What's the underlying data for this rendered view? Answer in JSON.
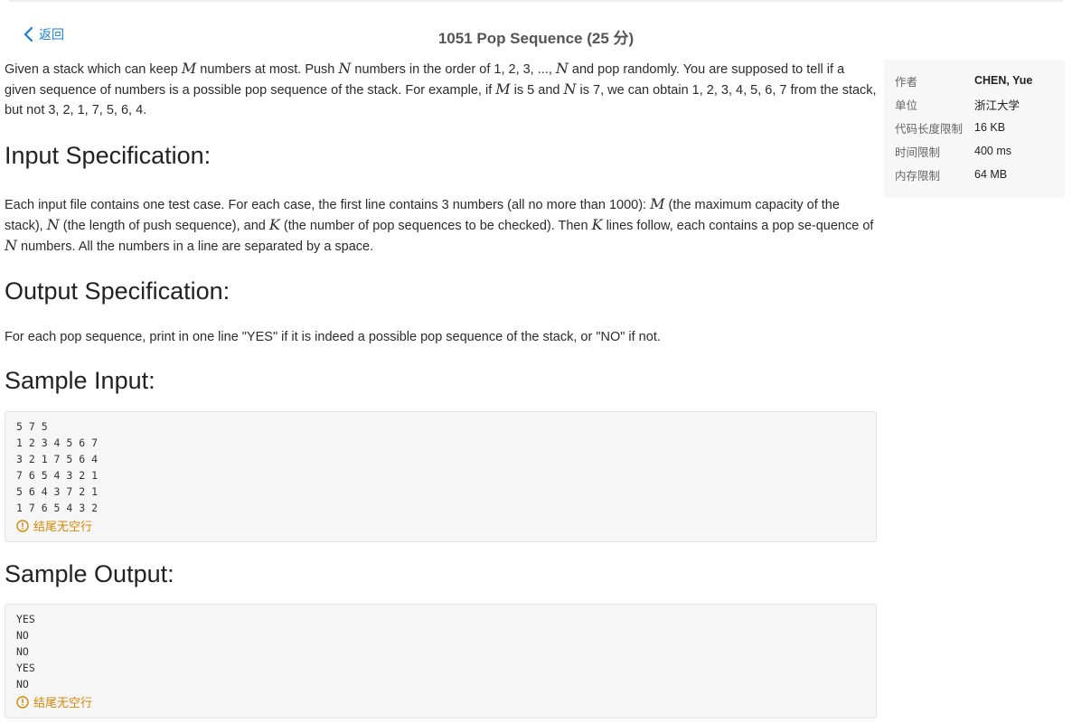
{
  "header": {
    "back_label": "返回",
    "title": "1051 Pop Sequence (25 分)"
  },
  "intro": {
    "p1": "Given a stack which can keep ",
    "m1": "M",
    "p2": " numbers at most. Push ",
    "n1": "N",
    "p3": " numbers in the order of 1, 2, 3, ..., ",
    "n2": "N",
    "p4": " and pop randomly. You are supposed to tell if a given sequence of numbers is a possible pop sequence of the stack. For example, if ",
    "m2": "M",
    "p5": " is 5 and ",
    "n3": "N",
    "p6": " is 7, we can obtain 1, 2, 3, 4, 5, 6, 7 from the stack, but not 3, 2, 1, 7, 5, 6, 4."
  },
  "input_spec": {
    "heading": "Input Specification:",
    "p1": "Each input file contains one test case. For each case, the first line contains 3 numbers (all no more than 1000): ",
    "m": "M",
    "p2": " (the maximum capacity of the stack), ",
    "n": "N",
    "p3": " (the length of push sequence), and ",
    "k": "K",
    "p4": " (the number of pop sequences to be checked). Then ",
    "k2": "K",
    "p5": " lines follow, each contains a pop se-quence of ",
    "n2": "N",
    "p6": " numbers. All the numbers in a line are separated by a space."
  },
  "output_spec": {
    "heading": "Output Specification:",
    "text": "For each pop sequence, print in one line \"YES\" if it is indeed a possible pop sequence of the stack, or \"NO\" if not."
  },
  "sample_input": {
    "heading": "Sample Input:",
    "code": "5 7 5\n1 2 3 4 5 6 7\n3 2 1 7 5 6 4\n7 6 5 4 3 2 1\n5 6 4 3 7 2 1\n1 7 6 5 4 3 2",
    "note": "结尾无空行"
  },
  "sample_output": {
    "heading": "Sample Output:",
    "code": "YES\nNO\nNO\nYES\nNO",
    "note": "结尾无空行"
  },
  "sidebar": {
    "rows": [
      {
        "key": "作者",
        "value": "CHEN, Yue"
      },
      {
        "key": "单位",
        "value": "浙江大学"
      },
      {
        "key": "代码长度限制",
        "value": "16 KB"
      },
      {
        "key": "时间限制",
        "value": "400 ms"
      },
      {
        "key": "内存限制",
        "value": "64 MB"
      }
    ]
  },
  "colors": {
    "link": "#1a7fd6",
    "warning": "#d48806"
  }
}
